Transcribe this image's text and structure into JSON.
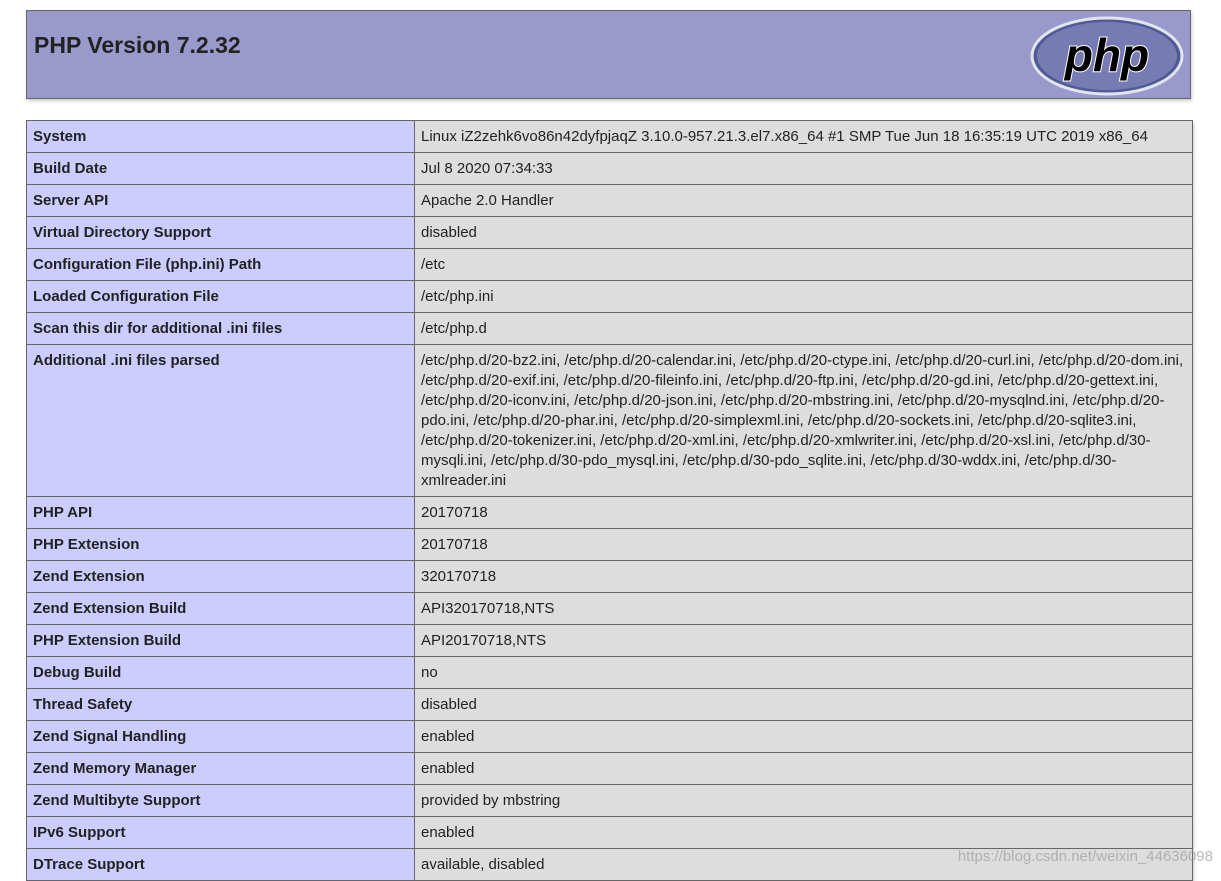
{
  "header": {
    "title": "PHP Version 7.2.32",
    "logo_text": "php"
  },
  "colors": {
    "header_bg": "#9999cc",
    "label_cell_bg": "#ccccff",
    "value_cell_bg": "#dddddd",
    "border": "#666666"
  },
  "rows": [
    {
      "label": "System",
      "value": "Linux iZ2zehk6vo86n42dyfpjaqZ 3.10.0-957.21.3.el7.x86_64 #1 SMP Tue Jun 18 16:35:19 UTC 2019 x86_64"
    },
    {
      "label": "Build Date",
      "value": "Jul 8 2020 07:34:33"
    },
    {
      "label": "Server API",
      "value": "Apache 2.0 Handler"
    },
    {
      "label": "Virtual Directory Support",
      "value": "disabled"
    },
    {
      "label": "Configuration File (php.ini) Path",
      "value": "/etc"
    },
    {
      "label": "Loaded Configuration File",
      "value": "/etc/php.ini"
    },
    {
      "label": "Scan this dir for additional .ini files",
      "value": "/etc/php.d"
    },
    {
      "label": "Additional .ini files parsed",
      "value": "/etc/php.d/20-bz2.ini, /etc/php.d/20-calendar.ini, /etc/php.d/20-ctype.ini, /etc/php.d/20-curl.ini, /etc/php.d/20-dom.ini, /etc/php.d/20-exif.ini, /etc/php.d/20-fileinfo.ini, /etc/php.d/20-ftp.ini, /etc/php.d/20-gd.ini, /etc/php.d/20-gettext.ini, /etc/php.d/20-iconv.ini, /etc/php.d/20-json.ini, /etc/php.d/20-mbstring.ini, /etc/php.d/20-mysqlnd.ini, /etc/php.d/20-pdo.ini, /etc/php.d/20-phar.ini, /etc/php.d/20-simplexml.ini, /etc/php.d/20-sockets.ini, /etc/php.d/20-sqlite3.ini, /etc/php.d/20-tokenizer.ini, /etc/php.d/20-xml.ini, /etc/php.d/20-xmlwriter.ini, /etc/php.d/20-xsl.ini, /etc/php.d/30-mysqli.ini, /etc/php.d/30-pdo_mysql.ini, /etc/php.d/30-pdo_sqlite.ini, /etc/php.d/30-wddx.ini, /etc/php.d/30-xmlreader.ini"
    },
    {
      "label": "PHP API",
      "value": "20170718"
    },
    {
      "label": "PHP Extension",
      "value": "20170718"
    },
    {
      "label": "Zend Extension",
      "value": "320170718"
    },
    {
      "label": "Zend Extension Build",
      "value": "API320170718,NTS"
    },
    {
      "label": "PHP Extension Build",
      "value": "API20170718,NTS"
    },
    {
      "label": "Debug Build",
      "value": "no"
    },
    {
      "label": "Thread Safety",
      "value": "disabled"
    },
    {
      "label": "Zend Signal Handling",
      "value": "enabled"
    },
    {
      "label": "Zend Memory Manager",
      "value": "enabled"
    },
    {
      "label": "Zend Multibyte Support",
      "value": "provided by mbstring"
    },
    {
      "label": "IPv6 Support",
      "value": "enabled"
    },
    {
      "label": "DTrace Support",
      "value": "available, disabled"
    }
  ],
  "watermark": "https://blog.csdn.net/weixin_44636098"
}
